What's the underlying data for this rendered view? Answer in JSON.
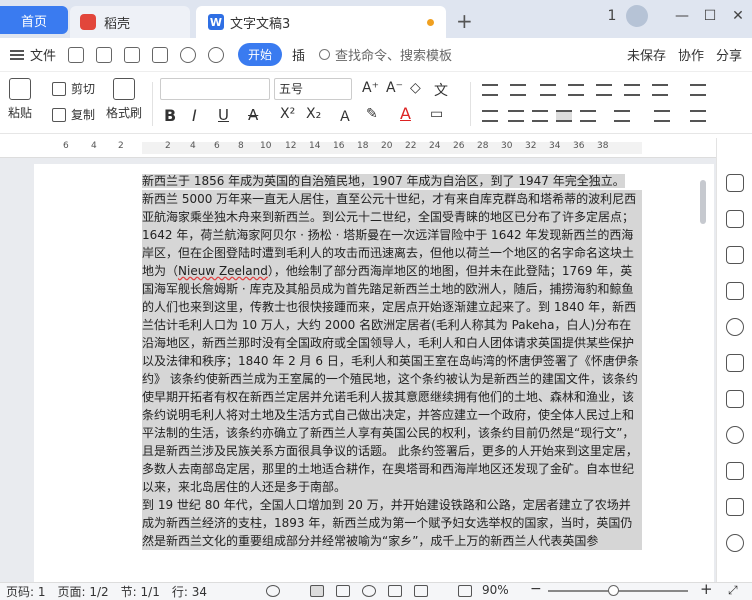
{
  "tabs": {
    "home": "首页",
    "wps": "稻壳",
    "doc": "文字文稿3",
    "add": "+"
  },
  "window": {
    "badge": "1",
    "minimize": "—",
    "maximize": "☐",
    "close": "✕"
  },
  "menu": {
    "file": "文件",
    "start": "开始",
    "insert_cut": "插",
    "search": "查找命令、搜索模板",
    "unsaved": "未保存",
    "collab": "协作",
    "share": "分享"
  },
  "ribbon": {
    "paste": "粘贴",
    "cut": "剪切",
    "copy": "复制",
    "format_painter": "格式刷",
    "font_name": "",
    "font_size": "五号",
    "bold": "B",
    "italic": "I",
    "underline": "U",
    "strike": "A",
    "superscript": "X²",
    "subscript": "X₂",
    "font_color": "A"
  },
  "ruler": {
    "numbers": [
      "6",
      "4",
      "2",
      "2",
      "4",
      "6",
      "8",
      "10",
      "12",
      "14",
      "16",
      "18",
      "20",
      "22",
      "24",
      "26",
      "28",
      "30",
      "32",
      "34",
      "36",
      "38"
    ]
  },
  "document": {
    "p1": "新西兰于 1856 年成为英国的自治殖民地，1907 年成为自治区，到了 1947 年完全独立。",
    "p2a": "新西兰 5000 万年来一直无人居住，直至公元十世纪，才有来自库克群岛和塔希蒂的波利尼西亚航海家乘坐独木舟来到新西兰。到公元十二世纪，全国受青睐的地区已分布了许多定居点；1642 年，荷兰航海家阿贝尔 · 扬松 · 塔斯曼在一次远洋冒险中于 1642 年发现新西兰的西海岸区，但在企图登陆时遭到毛利人的攻击而迅速离去，但他以荷兰一个地区的名字命名这块土地为（",
    "p2nz": "Nieuw Zeeland",
    "p2b": "），他绘制了部分西海岸地区的地图，但并未在此登陆；1769 年，英国海军舰长詹姆斯 · 库克及其船员成为首先踏足新西兰土地的欧洲人，随后，捕捞海豹和鲸鱼的人们也来到这里，传教士也很快接踵而来，定居点开始逐渐建立起来了。到 1840 年，新西兰估计毛利人口为 10 万人，大约 2000 名欧洲定居者(毛利人称其为 Pakeha，白人)分布在沿海地区，新西兰那时没有全国政府或全国领导人，毛利人和白人团体请求英国提供某些保护以及法律和秩序；1840 年 2 月 6 日，毛利人和英国王室在岛屿湾的怀唐伊签署了《怀唐伊条约》 该条约使新西兰成为王室属的一个殖民地，这个条约被认为是新西兰的建国文件，该条约使早期开拓者有权在新西兰定居并允诺毛利人拔其意愿继续拥有他们的土地、森林和渔业，该条约说明毛利人将对土地及生活方式自己做出决定，并答应建立一个政府，使全体人民过上和平法制的生活，该条约亦确立了新西兰人享有英国公民的权利，该条约目前仍然是“现行文”，且是新西兰涉及民族关系方面很具争议的话题。 此条约签署后，更多的人开始来到这里定居，多数人去南部岛定居，那里的土地适合耕作，在奥塔哥和西海岸地区还发现了金矿。自本世纪以来，来北岛居住的人还是多于南部。",
    "p3": "到 19 世纪 80 年代，全国人口增加到 20 万，并开始建设铁路和公路，定居者建立了农场并成为新西兰经济的支柱，1893 年，新西兰成为第一个赋予妇女选举权的国家，当时，英国仍然是新西兰文化的重要组成部分并经常被喻为“家乡”，成千上万的新西兰人代表英国参"
  },
  "status": {
    "page": "页码: 1",
    "pages": "页面: 1/2",
    "section": "节: 1/1",
    "line": "行: 34",
    "zoom": "90%",
    "minus": "−",
    "plus": "+"
  }
}
